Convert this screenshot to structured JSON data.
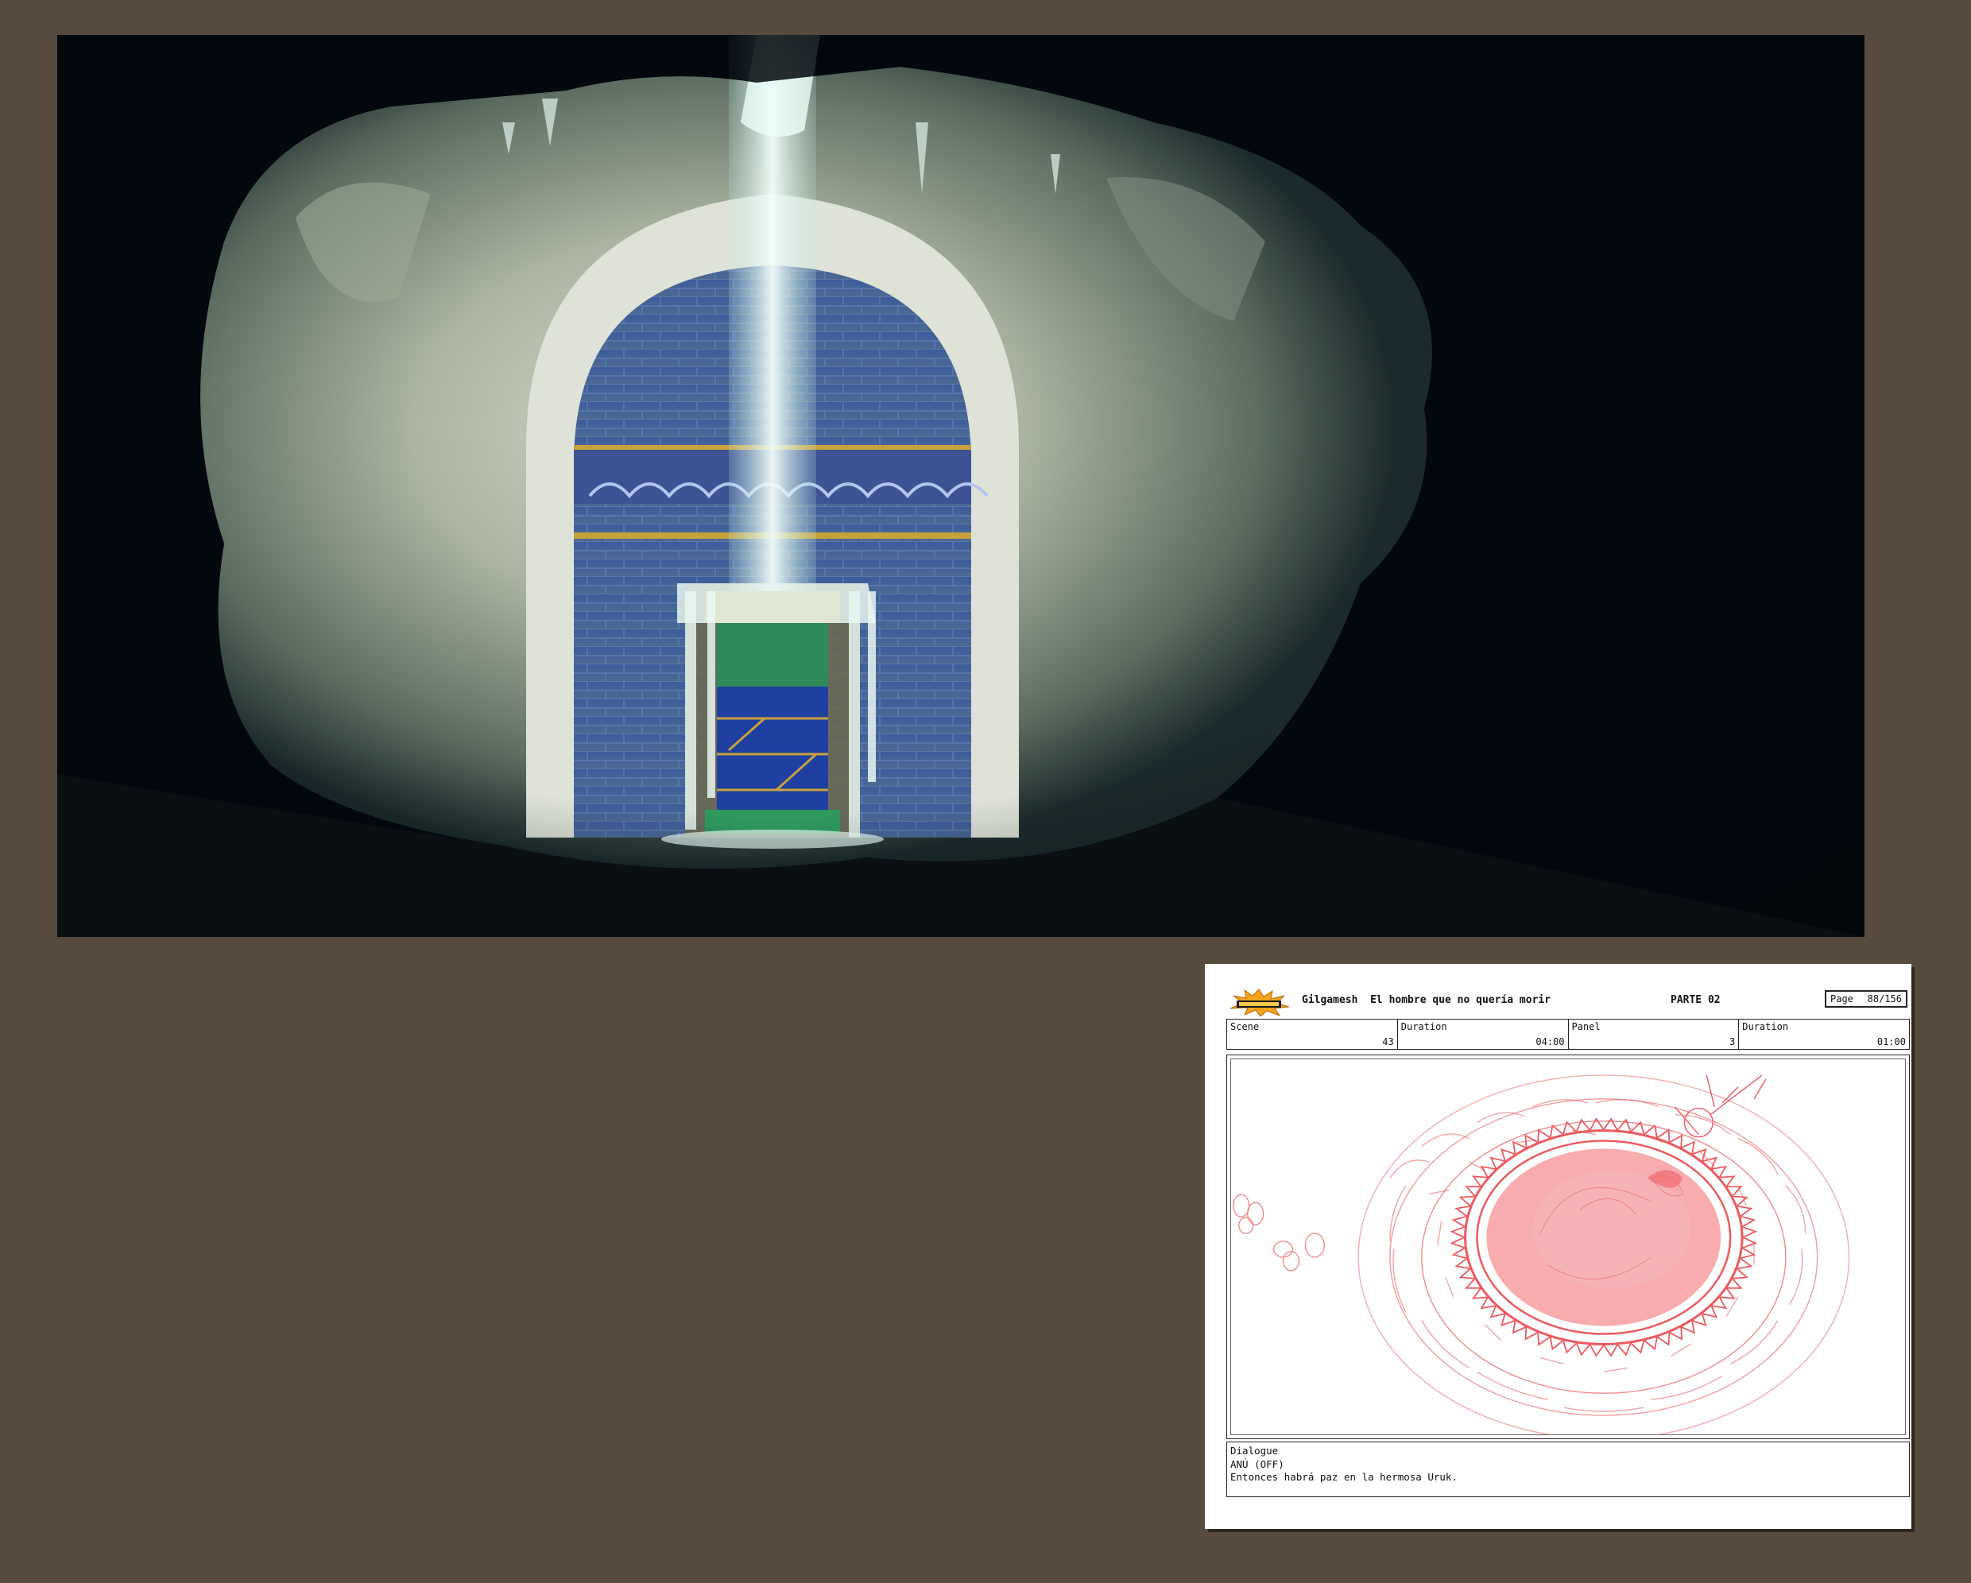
{
  "painting": {
    "subject": "painted background of a cave opening onto an arched tiled alcove with a glowing waterfall over a pillar"
  },
  "storyboard": {
    "logo": "toon-boom-logo",
    "title": "Gilgamesh  El hombre que no quería morir",
    "part": "PARTE 02",
    "page_label": "Page",
    "page_value": "88/156",
    "fields": [
      {
        "label": "Scene",
        "value": "43"
      },
      {
        "label": "Duration",
        "value": "04:00"
      },
      {
        "label": "Panel",
        "value": "3"
      },
      {
        "label": "Duration",
        "value": "01:00"
      }
    ],
    "dialogue": {
      "heading": "Dialogue",
      "speaker": "ANÚ (OFF)",
      "line": "Entonces habrá paz en la hermosa Uruk."
    }
  },
  "colors": {
    "background": "#574b3e",
    "sketch_red": "#e8454a",
    "tile_blue": "#3b5fa0"
  }
}
